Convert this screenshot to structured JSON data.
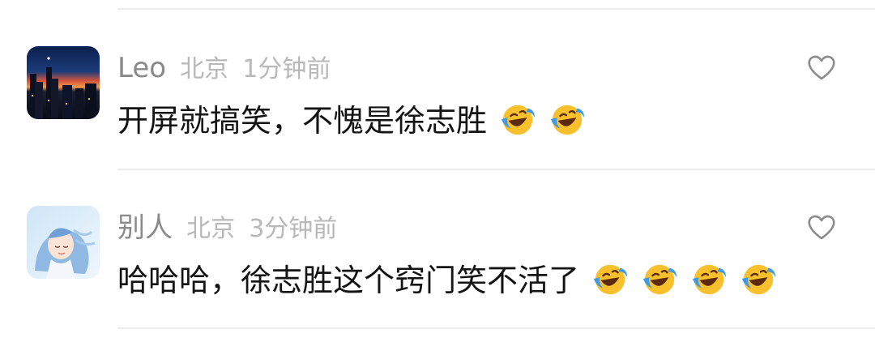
{
  "comments": [
    {
      "username": "Leo",
      "location": "北京",
      "time": "1分钟前",
      "text": "开屏就搞笑，不愧是徐志胜",
      "emojis": [
        "rolling-on-floor-laughing",
        "rolling-on-floor-laughing"
      ]
    },
    {
      "username": "别人",
      "location": "北京",
      "time": "3分钟前",
      "text": "哈哈哈，徐志胜这个窍门笑不活了",
      "emojis": [
        "rolling-on-floor-laughing",
        "rolling-on-floor-laughing",
        "rolling-on-floor-laughing",
        "rolling-on-floor-laughing"
      ]
    }
  ],
  "colors": {
    "username": "#8a8a8a",
    "meta": "#b8b8b8",
    "text": "#141414",
    "divider": "#ececec",
    "like_icon": "#8a8a8a"
  },
  "icons": {
    "like": "heart-outline-icon",
    "emoji": "laughing-tears-emoji"
  }
}
